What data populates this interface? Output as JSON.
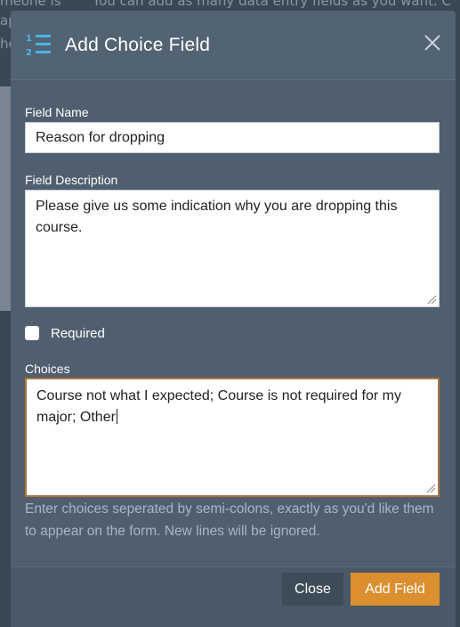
{
  "background": {
    "line1_left": "meone is",
    "line1_right": "You can add as many data entry fields as you want. C",
    "line2_left": "ap",
    "line3_left": "he"
  },
  "modal": {
    "title": "Add Choice Field",
    "icon": "numbered-list-icon",
    "close_icon": "close-icon",
    "fields": {
      "name_label": "Field Name",
      "name_value": "Reason for dropping",
      "description_label": "Field Description",
      "description_value": "Please give us some indication why you are dropping this course.",
      "required_label": "Required",
      "required_checked": false,
      "choices_label": "Choices",
      "choices_value": "Course not what I expected; Course is not required for my major; Other",
      "choices_help": "Enter choices seperated by semi-colons, exactly as you'd like them to appear on the form. New lines will be ignored."
    },
    "footer": {
      "close_label": "Close",
      "add_label": "Add Field"
    }
  },
  "colors": {
    "accent": "#dc8f2f",
    "icon_blue": "#4db6e6",
    "modal_bg": "#4f5f6f",
    "focus_border": "#a0784e"
  }
}
